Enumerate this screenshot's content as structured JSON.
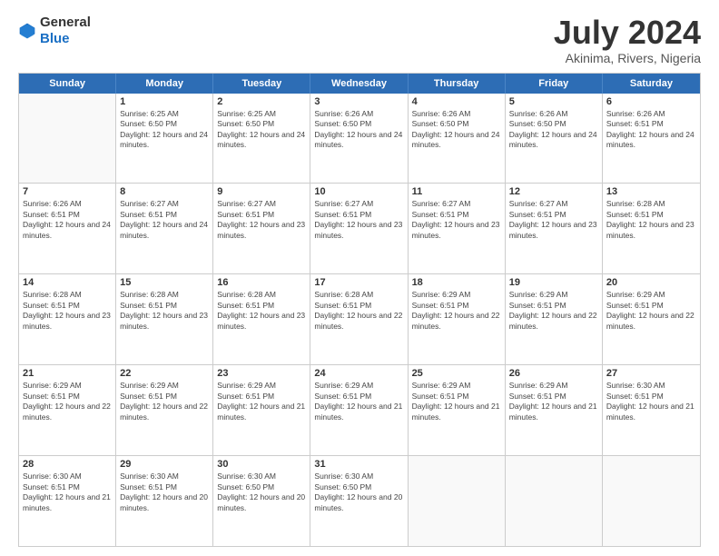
{
  "header": {
    "logo": {
      "general": "General",
      "blue": "Blue"
    },
    "title": "July 2024",
    "location": "Akinima, Rivers, Nigeria"
  },
  "calendar": {
    "days_of_week": [
      "Sunday",
      "Monday",
      "Tuesday",
      "Wednesday",
      "Thursday",
      "Friday",
      "Saturday"
    ],
    "rows": [
      [
        {
          "day": "",
          "sunrise": "",
          "sunset": "",
          "daylight": ""
        },
        {
          "day": "1",
          "sunrise": "Sunrise: 6:25 AM",
          "sunset": "Sunset: 6:50 PM",
          "daylight": "Daylight: 12 hours and 24 minutes."
        },
        {
          "day": "2",
          "sunrise": "Sunrise: 6:25 AM",
          "sunset": "Sunset: 6:50 PM",
          "daylight": "Daylight: 12 hours and 24 minutes."
        },
        {
          "day": "3",
          "sunrise": "Sunrise: 6:26 AM",
          "sunset": "Sunset: 6:50 PM",
          "daylight": "Daylight: 12 hours and 24 minutes."
        },
        {
          "day": "4",
          "sunrise": "Sunrise: 6:26 AM",
          "sunset": "Sunset: 6:50 PM",
          "daylight": "Daylight: 12 hours and 24 minutes."
        },
        {
          "day": "5",
          "sunrise": "Sunrise: 6:26 AM",
          "sunset": "Sunset: 6:50 PM",
          "daylight": "Daylight: 12 hours and 24 minutes."
        },
        {
          "day": "6",
          "sunrise": "Sunrise: 6:26 AM",
          "sunset": "Sunset: 6:51 PM",
          "daylight": "Daylight: 12 hours and 24 minutes."
        }
      ],
      [
        {
          "day": "7",
          "sunrise": "Sunrise: 6:26 AM",
          "sunset": "Sunset: 6:51 PM",
          "daylight": "Daylight: 12 hours and 24 minutes."
        },
        {
          "day": "8",
          "sunrise": "Sunrise: 6:27 AM",
          "sunset": "Sunset: 6:51 PM",
          "daylight": "Daylight: 12 hours and 24 minutes."
        },
        {
          "day": "9",
          "sunrise": "Sunrise: 6:27 AM",
          "sunset": "Sunset: 6:51 PM",
          "daylight": "Daylight: 12 hours and 23 minutes."
        },
        {
          "day": "10",
          "sunrise": "Sunrise: 6:27 AM",
          "sunset": "Sunset: 6:51 PM",
          "daylight": "Daylight: 12 hours and 23 minutes."
        },
        {
          "day": "11",
          "sunrise": "Sunrise: 6:27 AM",
          "sunset": "Sunset: 6:51 PM",
          "daylight": "Daylight: 12 hours and 23 minutes."
        },
        {
          "day": "12",
          "sunrise": "Sunrise: 6:27 AM",
          "sunset": "Sunset: 6:51 PM",
          "daylight": "Daylight: 12 hours and 23 minutes."
        },
        {
          "day": "13",
          "sunrise": "Sunrise: 6:28 AM",
          "sunset": "Sunset: 6:51 PM",
          "daylight": "Daylight: 12 hours and 23 minutes."
        }
      ],
      [
        {
          "day": "14",
          "sunrise": "Sunrise: 6:28 AM",
          "sunset": "Sunset: 6:51 PM",
          "daylight": "Daylight: 12 hours and 23 minutes."
        },
        {
          "day": "15",
          "sunrise": "Sunrise: 6:28 AM",
          "sunset": "Sunset: 6:51 PM",
          "daylight": "Daylight: 12 hours and 23 minutes."
        },
        {
          "day": "16",
          "sunrise": "Sunrise: 6:28 AM",
          "sunset": "Sunset: 6:51 PM",
          "daylight": "Daylight: 12 hours and 23 minutes."
        },
        {
          "day": "17",
          "sunrise": "Sunrise: 6:28 AM",
          "sunset": "Sunset: 6:51 PM",
          "daylight": "Daylight: 12 hours and 22 minutes."
        },
        {
          "day": "18",
          "sunrise": "Sunrise: 6:29 AM",
          "sunset": "Sunset: 6:51 PM",
          "daylight": "Daylight: 12 hours and 22 minutes."
        },
        {
          "day": "19",
          "sunrise": "Sunrise: 6:29 AM",
          "sunset": "Sunset: 6:51 PM",
          "daylight": "Daylight: 12 hours and 22 minutes."
        },
        {
          "day": "20",
          "sunrise": "Sunrise: 6:29 AM",
          "sunset": "Sunset: 6:51 PM",
          "daylight": "Daylight: 12 hours and 22 minutes."
        }
      ],
      [
        {
          "day": "21",
          "sunrise": "Sunrise: 6:29 AM",
          "sunset": "Sunset: 6:51 PM",
          "daylight": "Daylight: 12 hours and 22 minutes."
        },
        {
          "day": "22",
          "sunrise": "Sunrise: 6:29 AM",
          "sunset": "Sunset: 6:51 PM",
          "daylight": "Daylight: 12 hours and 22 minutes."
        },
        {
          "day": "23",
          "sunrise": "Sunrise: 6:29 AM",
          "sunset": "Sunset: 6:51 PM",
          "daylight": "Daylight: 12 hours and 21 minutes."
        },
        {
          "day": "24",
          "sunrise": "Sunrise: 6:29 AM",
          "sunset": "Sunset: 6:51 PM",
          "daylight": "Daylight: 12 hours and 21 minutes."
        },
        {
          "day": "25",
          "sunrise": "Sunrise: 6:29 AM",
          "sunset": "Sunset: 6:51 PM",
          "daylight": "Daylight: 12 hours and 21 minutes."
        },
        {
          "day": "26",
          "sunrise": "Sunrise: 6:29 AM",
          "sunset": "Sunset: 6:51 PM",
          "daylight": "Daylight: 12 hours and 21 minutes."
        },
        {
          "day": "27",
          "sunrise": "Sunrise: 6:30 AM",
          "sunset": "Sunset: 6:51 PM",
          "daylight": "Daylight: 12 hours and 21 minutes."
        }
      ],
      [
        {
          "day": "28",
          "sunrise": "Sunrise: 6:30 AM",
          "sunset": "Sunset: 6:51 PM",
          "daylight": "Daylight: 12 hours and 21 minutes."
        },
        {
          "day": "29",
          "sunrise": "Sunrise: 6:30 AM",
          "sunset": "Sunset: 6:51 PM",
          "daylight": "Daylight: 12 hours and 20 minutes."
        },
        {
          "day": "30",
          "sunrise": "Sunrise: 6:30 AM",
          "sunset": "Sunset: 6:50 PM",
          "daylight": "Daylight: 12 hours and 20 minutes."
        },
        {
          "day": "31",
          "sunrise": "Sunrise: 6:30 AM",
          "sunset": "Sunset: 6:50 PM",
          "daylight": "Daylight: 12 hours and 20 minutes."
        },
        {
          "day": "",
          "sunrise": "",
          "sunset": "",
          "daylight": ""
        },
        {
          "day": "",
          "sunrise": "",
          "sunset": "",
          "daylight": ""
        },
        {
          "day": "",
          "sunrise": "",
          "sunset": "",
          "daylight": ""
        }
      ]
    ]
  }
}
